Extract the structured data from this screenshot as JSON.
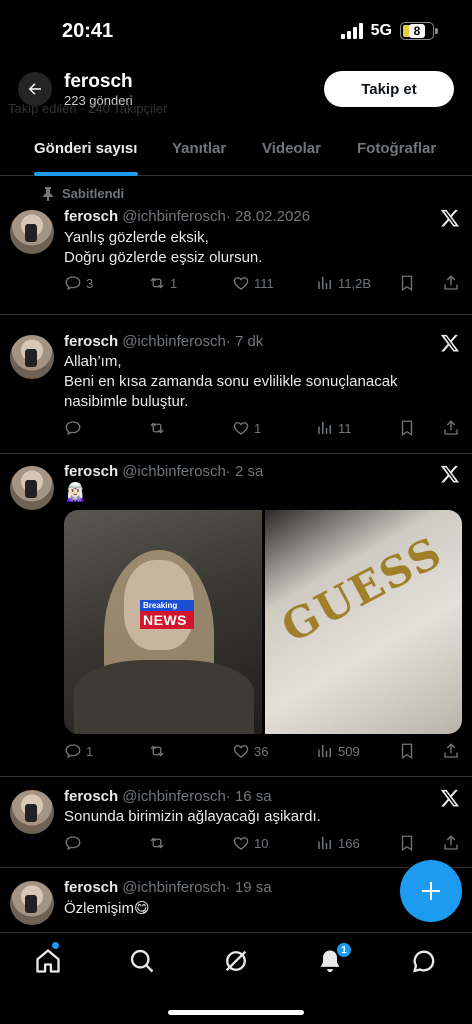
{
  "status_bar": {
    "time": "20:41",
    "network": "5G",
    "battery": "8"
  },
  "header": {
    "name": "ferosch",
    "post_count": "223 gönderi",
    "follow_label": "Takip et",
    "ghost_text": "Takip edilen · 240 Takipçiler"
  },
  "tabs": [
    {
      "label": "Gönderi sayısı",
      "active": true
    },
    {
      "label": "Yanıtlar",
      "active": false
    },
    {
      "label": "Videolar",
      "active": false
    },
    {
      "label": "Fotoğraflar",
      "active": false
    }
  ],
  "pinned_label": "Sabitlendi",
  "posts": [
    {
      "name": "ferosch",
      "handle": "@ichbinferosch",
      "time": "· 28.02.2026",
      "text": "Yanlış gözlerde eksik,\nDoğru gözlerde eşsiz olursun.",
      "replies": "3",
      "reposts": "1",
      "likes": "111",
      "views": "11,2B"
    },
    {
      "name": "ferosch",
      "handle": "@ichbinferosch",
      "time": "· 7 dk",
      "text": "Allah’ım,\nBeni en kısa zamanda sonu evlilikle sonuçlanacak\nnasibimle buluştur.",
      "replies": "",
      "reposts": "",
      "likes": "1",
      "views": "11"
    },
    {
      "name": "ferosch",
      "handle": "@ichbinferosch",
      "time": "· 2 sa",
      "text": "🧝🏻‍♀️",
      "replies": "1",
      "reposts": "",
      "likes": "36",
      "views": "509",
      "media": {
        "breaking_top": "Breaking",
        "breaking_bottom": "NEWS",
        "bag_text": "GUESS"
      }
    },
    {
      "name": "ferosch",
      "handle": "@ichbinferosch",
      "time": "· 16 sa",
      "text": "Sonunda birimizin ağlayacağı aşikardı.",
      "replies": "",
      "reposts": "",
      "likes": "10",
      "views": "166"
    },
    {
      "name": "ferosch",
      "handle": "@ichbinferosch",
      "time": "· 19 sa",
      "text": "Özlemişim😋"
    }
  ],
  "bottom_nav": {
    "notification_badge": "1"
  },
  "colors": {
    "accent": "#1d9bf0",
    "muted": "#71767b",
    "divider": "#2f3336"
  }
}
